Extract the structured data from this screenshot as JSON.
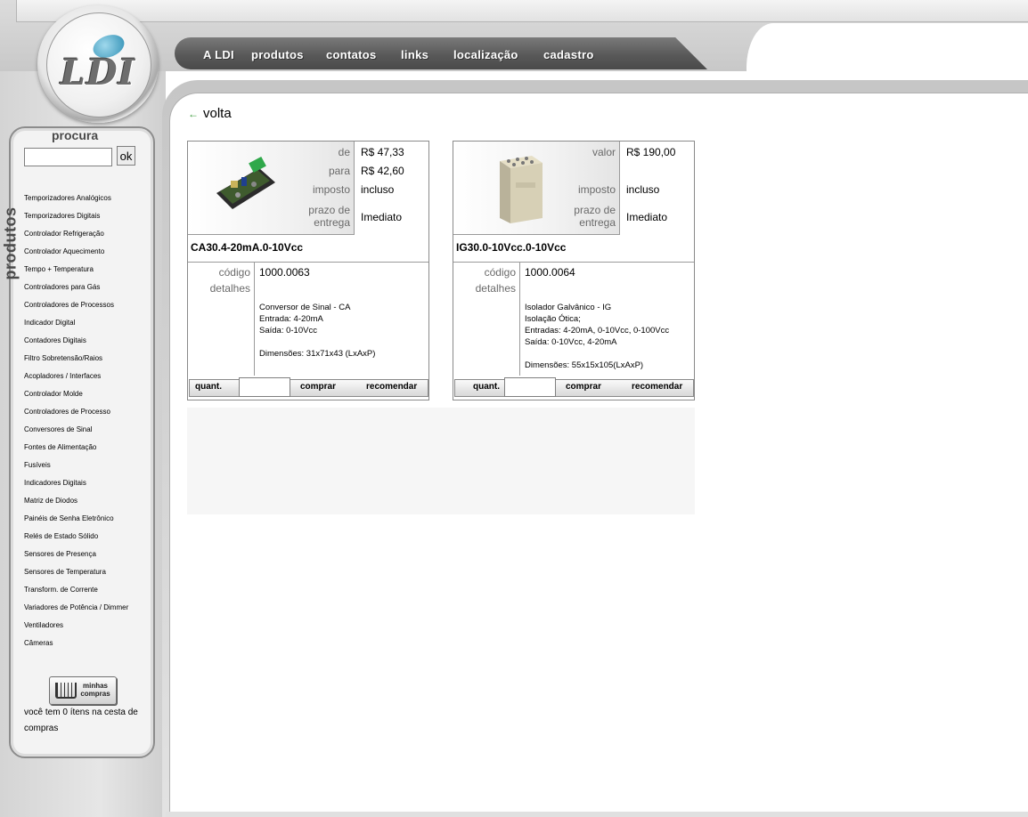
{
  "logo": {
    "text": "LDI"
  },
  "nav": {
    "items": [
      {
        "label": "A LDI"
      },
      {
        "label": "produtos"
      },
      {
        "label": "contatos"
      },
      {
        "label": "links"
      },
      {
        "label": "localização"
      },
      {
        "label": "cadastro"
      }
    ]
  },
  "sidebar": {
    "search_title": "procura",
    "search_value": "",
    "search_button": "ok",
    "vertical_label": "produtos",
    "categories": [
      "Temporizadores Analógicos",
      "Temporizadores Digitais",
      "Controlador Refrigeração",
      "Controlador Aquecimento",
      "Tempo + Temperatura",
      "Controladores para Gás",
      "Controladores de Processos",
      "Indicador Digital",
      "Contadores Digitais",
      "Filtro Sobretensão/Raios",
      "Acopladores / Interfaces",
      "Controlador Molde",
      "Controladores de Processo",
      "Conversores de Sinal",
      "Fontes de Alimentação",
      "Fusíveis",
      "Indicadores Digitais",
      "Matriz de Diodos",
      "Painéis de Senha Eletrônico",
      "Relés de Estado Sólido",
      "Sensores de Presença",
      "Sensores de Temperatura",
      "Transform. de Corrente",
      "Variadores de Potência / Dimmer",
      "Ventiladores",
      "Câmeras"
    ],
    "cart_button": {
      "line1": "minhas",
      "line2": "compras"
    },
    "cart_status": "você tem 0 ítens na cesta de compras"
  },
  "content": {
    "back_label": "volta",
    "products": [
      {
        "price_lines": [
          {
            "label": "de",
            "value": "R$ 47,33"
          },
          {
            "label": "para",
            "value": "R$ 42,60"
          }
        ],
        "tax_label": "imposto",
        "tax_value": "incluso",
        "delivery_label_1": "prazo de",
        "delivery_label_2": "entrega",
        "delivery_value": "Imediato",
        "name": "CA30.4-20mA.0-10Vcc",
        "code_label": "código",
        "code": "1000.0063",
        "details_label": "detalhes",
        "description": [
          "Conversor de Sinal - CA",
          "Entrada: 4-20mA",
          "Saída: 0-10Vcc",
          "",
          "Dimensões: 31x71x43 (LxAxP)"
        ],
        "qty_label": "quant.",
        "qty_value": "",
        "buy_label": "comprar",
        "recommend_label": "recomendar"
      },
      {
        "price_lines": [
          {
            "label": "valor",
            "value": "R$ 190,00"
          }
        ],
        "tax_label": "imposto",
        "tax_value": "incluso",
        "delivery_label_1": "prazo de",
        "delivery_label_2": "entrega",
        "delivery_value": "Imediato",
        "name": "IG30.0-10Vcc.0-10Vcc",
        "code_label": "código",
        "code": "1000.0064",
        "details_label": "detalhes",
        "description": [
          "Isolador Galvânico - IG",
          "Isolação Ótica;",
          "Entradas: 4-20mA, 0-10Vcc, 0-100Vcc",
          "Saída: 0-10Vcc, 4-20mA",
          "",
          "Dimensões: 55x15x105(LxAxP)"
        ],
        "qty_label": "quant.",
        "qty_value": "",
        "buy_label": "comprar",
        "recommend_label": "recomendar"
      }
    ]
  },
  "colors": {
    "nav_bg": "#595959",
    "frame_grey": "#c8c8c8",
    "arrow_green": "#3a9a3a"
  }
}
